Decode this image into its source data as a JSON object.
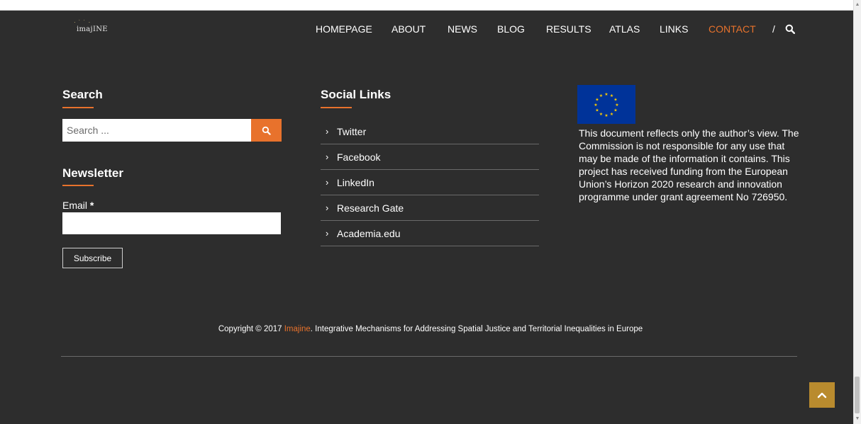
{
  "brand": {
    "logo_text": "imajINE",
    "logo_dots": "· ˙ ˙ ·"
  },
  "nav": {
    "items": [
      "HOMEPAGE",
      "ABOUT",
      "NEWS",
      "BLOG",
      "RESULTS",
      "ATLAS",
      "LINKS",
      "CONTACT"
    ],
    "active": "CONTACT",
    "separator": "/"
  },
  "search": {
    "title": "Search",
    "placeholder": "Search ..."
  },
  "newsletter": {
    "title": "Newsletter",
    "email_label": "Email",
    "required_mark": "*",
    "subscribe_label": "Subscribe"
  },
  "social": {
    "title": "Social Links",
    "items": [
      "Twitter",
      "Facebook",
      "LinkedIn",
      "Research Gate",
      "Academia.edu"
    ],
    "chevron": "›"
  },
  "eu": {
    "text": "This document reflects only the author’s view. The Commission is not responsible for any use that may be made of the information it contains. This project has received funding from the European Union’s Horizon 2020 research and innovation programme under grant agreement No 726950."
  },
  "footer": {
    "prefix": "Copyright © 2017 ",
    "link": "Imajine",
    "suffix": ". Integrative Mechanisms for Addressing Spatial Justice and Territorial Inequalities in Europe"
  },
  "colors": {
    "background": "#2d2d2d",
    "accent": "#e8722c",
    "back_to_top": "#b98b2e",
    "eu_blue": "#003399",
    "eu_star": "#ffcc00"
  }
}
